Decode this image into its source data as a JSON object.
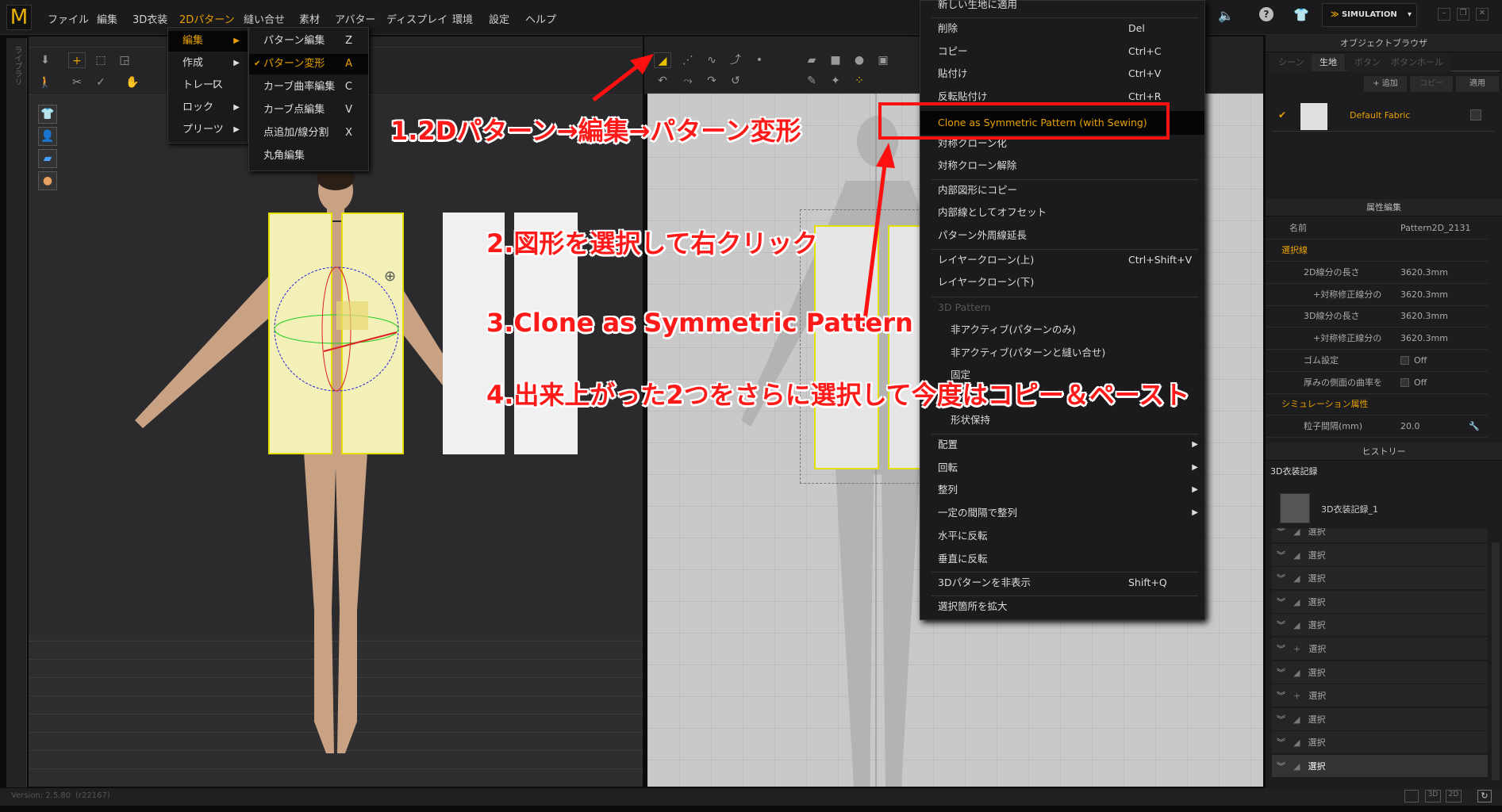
{
  "app": {
    "logo": "M",
    "version": "Version: 2.5.80",
    "build": "(r22167)",
    "library_label": "ライブラリ"
  },
  "menubar": [
    "ファイル",
    "編集",
    "3D衣装",
    "2Dパターン",
    "縫い合せ",
    "素材",
    "アバター",
    "ディスプレイ",
    "環境",
    "設定",
    "ヘルプ"
  ],
  "menubar_active": "2Dパターン",
  "menu_2d": [
    {
      "label": "編集",
      "arrow": true,
      "selected": true
    },
    {
      "label": "作成",
      "arrow": true
    },
    {
      "label": "トレース",
      "shortcut": "I"
    },
    {
      "label": "ロック",
      "arrow": true
    },
    {
      "label": "プリーツ",
      "arrow": true
    }
  ],
  "submenu_edit": [
    {
      "label": "パターン編集",
      "shortcut": "Z"
    },
    {
      "label": "パターン変形",
      "shortcut": "A",
      "checked": true
    },
    {
      "label": "カーブ曲率編集",
      "shortcut": "C"
    },
    {
      "label": "カーブ点編集",
      "shortcut": "V"
    },
    {
      "label": "点追加/線分割",
      "shortcut": "X"
    },
    {
      "label": "丸角編集"
    }
  ],
  "check_mark": "✔",
  "context_menu": [
    {
      "label": "新しい生地に適用"
    },
    {
      "label": "削除",
      "shortcut": "Del"
    },
    {
      "label": "コピー",
      "shortcut": "Ctrl+C"
    },
    {
      "label": "貼付け",
      "shortcut": "Ctrl+V"
    },
    {
      "label": "反転貼付け",
      "shortcut": "Ctrl+R"
    },
    {
      "label": "Clone as Symmetric Pattern (with Sewing)",
      "highlight": true
    },
    {
      "label": "対称クローン化"
    },
    {
      "label": "対称クローン解除"
    },
    {
      "label": "内部図形にコピー"
    },
    {
      "label": "内部線としてオフセット"
    },
    {
      "label": "パターン外周線延長"
    },
    {
      "label": "レイヤークローン(上)",
      "shortcut": "Ctrl+Shift+V"
    },
    {
      "label": "レイヤークローン(下)"
    },
    {
      "label": "3D Pattern",
      "disabled": true
    },
    {
      "label": "非アクティブ(パターンのみ)",
      "indent": true
    },
    {
      "label": "非アクティブ(パターンと縫い合せ)",
      "indent": true
    },
    {
      "label": "固定",
      "indent": true
    },
    {
      "label": "強化",
      "indent": true
    },
    {
      "label": "形状保持",
      "indent": true
    },
    {
      "label": "配置",
      "arrow": true
    },
    {
      "label": "回転",
      "arrow": true
    },
    {
      "label": "整列",
      "arrow": true
    },
    {
      "label": "一定の間隔で整列",
      "arrow": true
    },
    {
      "label": "水平に反転"
    },
    {
      "label": "垂直に反転"
    },
    {
      "label": "3Dパターンを非表示",
      "shortcut": "Shift+Q"
    },
    {
      "label": "選択箇所を拡大"
    }
  ],
  "annotations": {
    "step1": "1.2Dパターン→編集→パターン変形",
    "step2": "2.図形を選択して右クリック",
    "step3": "3.Clone as Symmetric Pattern",
    "step4": "4.出来上がった2つをさらに選択して今度はコピー＆ペースト",
    "color": "#ff1a1a"
  },
  "topright": {
    "simulation": "SIMULATION",
    "accent": "#e8a000"
  },
  "object_browser": {
    "title": "オブジェクトブラウザ",
    "tabs": [
      "シーン",
      "生地",
      "ボタン",
      "ボタンホール"
    ],
    "active_tab": "生地",
    "buttons": [
      "+ 追加",
      "コピー",
      "適用"
    ],
    "fabric": "Default Fabric"
  },
  "property_editor": {
    "title": "属性編集",
    "name_label": "名前",
    "name_value": "Pattern2D_2131",
    "section1": "選択線",
    "rows": [
      {
        "label": "2D線分の長さ",
        "value": "3620.3mm"
      },
      {
        "label": "+対称修正線分の",
        "value": "3620.3mm"
      },
      {
        "label": "3D線分の長さ",
        "value": "3620.3mm"
      },
      {
        "label": "+対称修正線分の",
        "value": "3620.3mm"
      },
      {
        "label": "ゴム設定",
        "value": "Off",
        "checkbox": true
      },
      {
        "label": "厚みの側面の曲率を",
        "value": "Off",
        "checkbox": true
      }
    ],
    "section2": "シミュレーション属性",
    "particle_label": "粒子間隔(mm)",
    "particle_value": "20.0"
  },
  "history": {
    "title": "ヒストリー",
    "record_title": "3D衣装記録",
    "record_item": "3D衣装記録_1",
    "items": [
      "選択",
      "選択",
      "選択",
      "選択",
      "選択",
      "選択",
      "選択",
      "選択",
      "選択",
      "選択",
      "選択"
    ]
  },
  "view_buttons": [
    "3D",
    "2D"
  ]
}
